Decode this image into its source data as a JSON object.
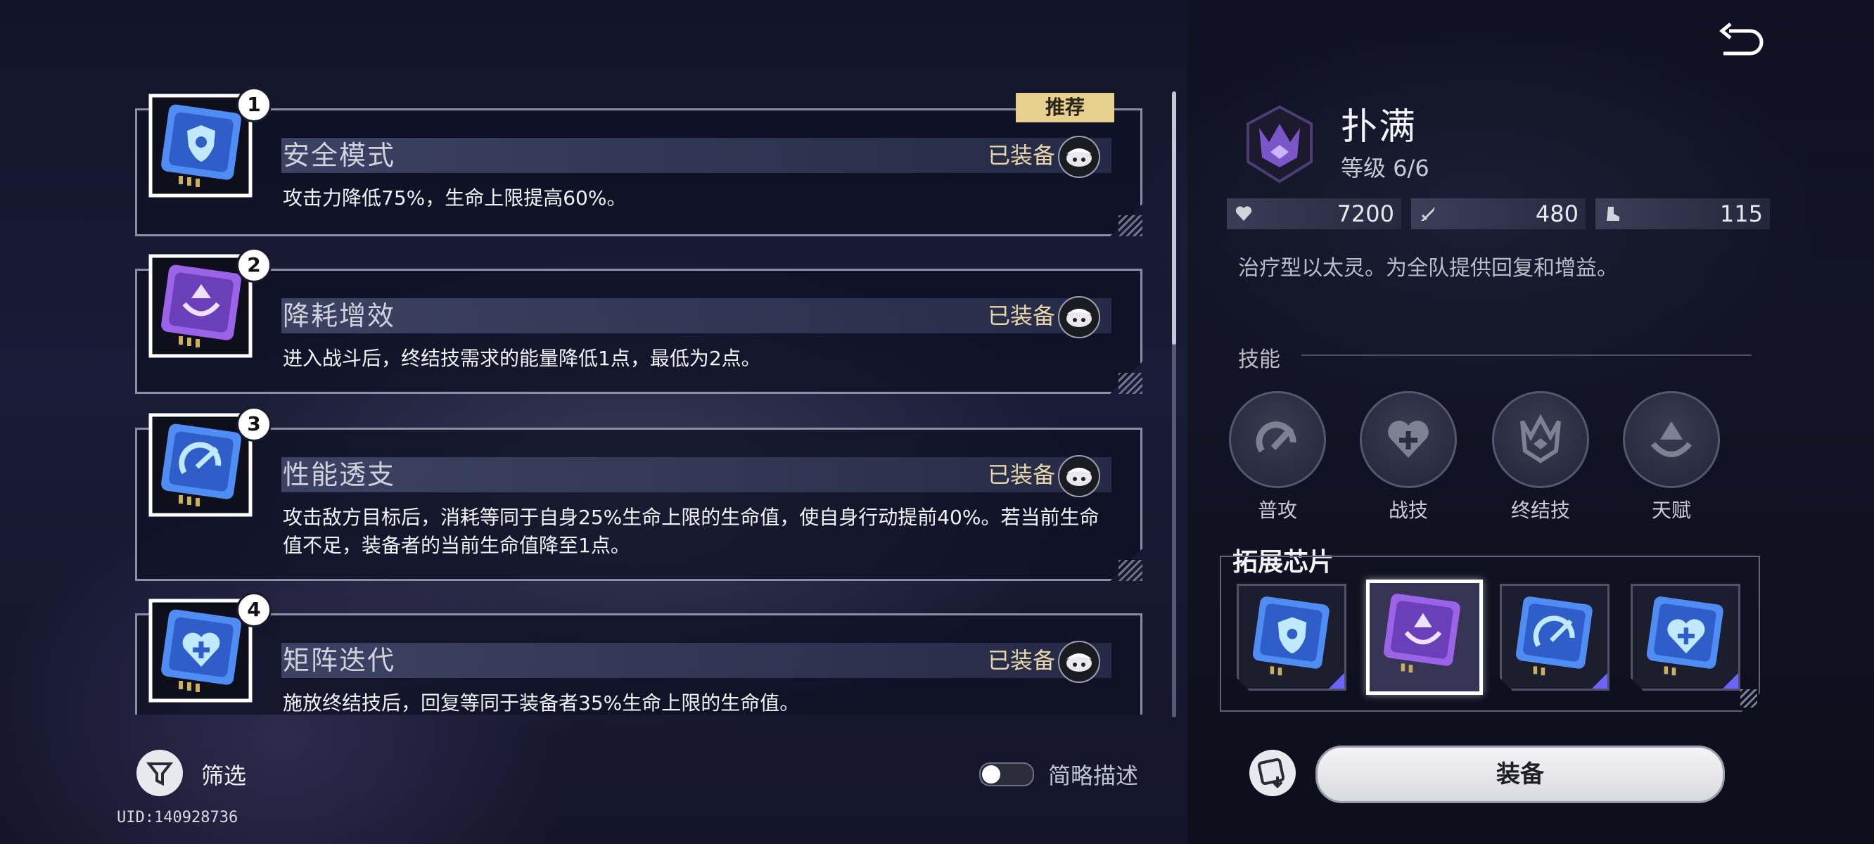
{
  "cards": [
    {
      "number": "1",
      "title": "安全模式",
      "equipped": "已装备",
      "desc": "攻击力降低75%，生命上限提高60%。",
      "recommend": "推荐"
    },
    {
      "number": "2",
      "title": "降耗增效",
      "equipped": "已装备",
      "desc": "进入战斗后，终结技需求的能量降低1点，最低为2点。"
    },
    {
      "number": "3",
      "title": "性能透支",
      "equipped": "已装备",
      "desc": "攻击敌方目标后，消耗等同于自身25%生命上限的生命值，使自身行动提前40%。若当前生命值不足，装备者的当前生命值降至1点。"
    },
    {
      "number": "4",
      "title": "矩阵迭代",
      "equipped": "已装备",
      "desc": "施放终结技后，回复等同于装备者35%生命上限的生命值。"
    }
  ],
  "filter": {
    "label": "筛选"
  },
  "uid": "UID:140928736",
  "toggle": {
    "label": "简略描述",
    "on": false
  },
  "character": {
    "name": "扑满",
    "level": "等级 6/6",
    "stats": {
      "hp": "7200",
      "atk": "480",
      "speed": "115"
    },
    "desc": "治疗型以太灵。为全队提供回复和增益。"
  },
  "skills": {
    "label": "技能",
    "items": [
      {
        "label": "普攻"
      },
      {
        "label": "战技"
      },
      {
        "label": "终结技"
      },
      {
        "label": "天赋"
      }
    ]
  },
  "extension": {
    "label": "拓展芯片",
    "selected_index": 1
  },
  "equip_button": "装备",
  "colors": {
    "recommend": "#e7cf8e",
    "equipped_text": "#e6d6a8",
    "chip_blue": "#4f8df5",
    "chip_purple": "#9a63e8",
    "slot_accent": "#6f63ff"
  }
}
